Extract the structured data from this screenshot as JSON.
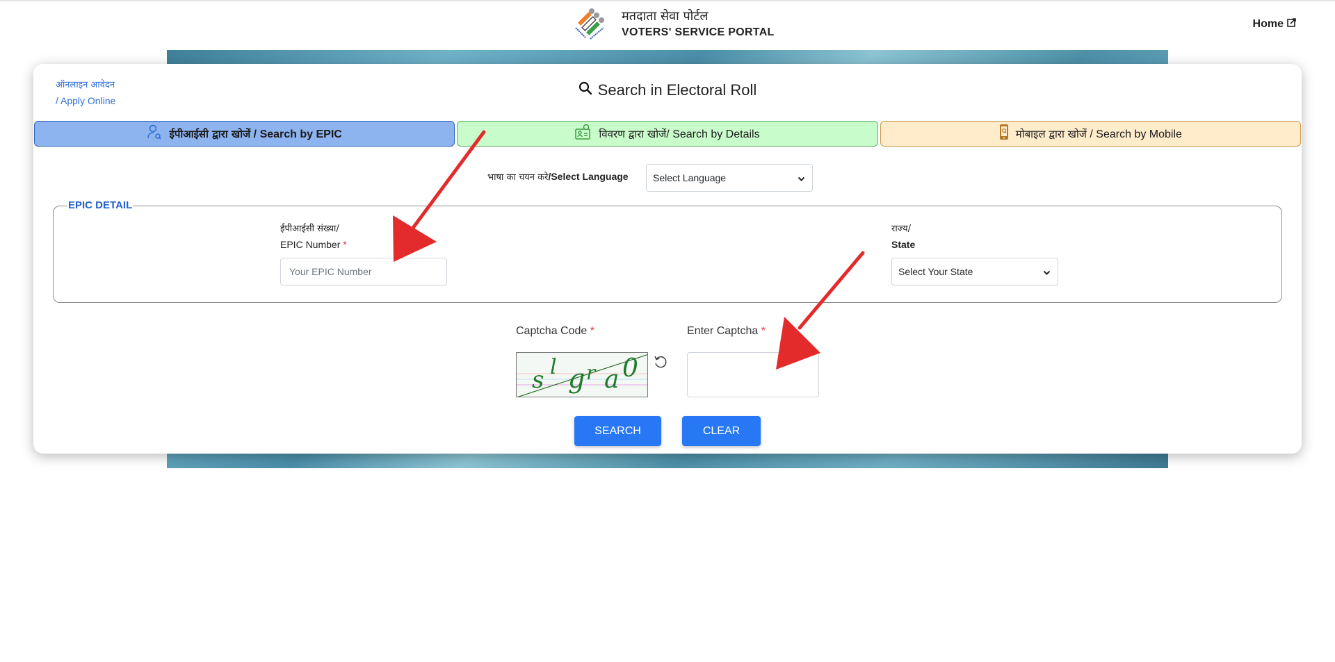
{
  "header": {
    "brand_hindi": "मतदाता सेवा पोर्टल",
    "brand_english": "VOTERS' SERVICE PORTAL",
    "logo_icon": "eci-ballot-logo-icon",
    "home_label": "Home",
    "home_icon": "external-link-icon"
  },
  "card": {
    "apply_online_hindi": "ऑनलाइन आवेदन",
    "apply_online_english": "/ Apply Online",
    "title": "Search in Electoral Roll",
    "title_icon": "search-icon"
  },
  "tabs": [
    {
      "hindi": "ईपीआईसी द्वारा खोजें",
      "english": " / Search by EPIC",
      "icon": "user-search-icon",
      "active": true,
      "color": "#8db4ef"
    },
    {
      "hindi": "विवरण द्वारा खोजें",
      "english": "/ Search by Details",
      "icon": "id-card-search-icon",
      "active": false,
      "color": "#c9fccb"
    },
    {
      "hindi": "मोबाइल द्वारा खोजें",
      "english": " / Search by Mobile",
      "icon": "mobile-search-icon",
      "active": false,
      "color": "#feeccb"
    }
  ],
  "language": {
    "label_hindi": "भाषा का चयन करे",
    "label_english": "/Select Language",
    "selected": "Select Language"
  },
  "epic_detail": {
    "legend": "EPIC DETAIL",
    "epic_label_hindi": "ईपीआईसी संख्या/",
    "epic_label_english": "EPIC Number",
    "epic_placeholder": "Your EPIC Number",
    "epic_value": "",
    "state_label_hindi": "राज्य/",
    "state_label_english": "State",
    "state_selected": "Select Your State",
    "required_mark": "*"
  },
  "captcha": {
    "code_label": "Captcha Code",
    "enter_label": "Enter Captcha",
    "required_mark": "*",
    "captcha_text": [
      "s",
      "l",
      "g",
      "r",
      "a",
      "0"
    ],
    "entered_value": "",
    "refresh_icon": "refresh-icon"
  },
  "buttons": {
    "search": "SEARCH",
    "clear": "CLEAR"
  },
  "annotations": {
    "arrow_color": "#e32b2b"
  }
}
